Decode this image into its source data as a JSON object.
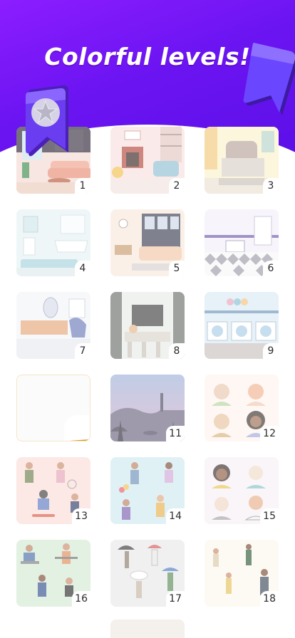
{
  "header": {
    "title": "Colorful levels!"
  },
  "levels": [
    {
      "number": "1",
      "theme": "living-room"
    },
    {
      "number": "2",
      "theme": "fireplace-room"
    },
    {
      "number": "3",
      "theme": "bedroom"
    },
    {
      "number": "4",
      "theme": "bathroom"
    },
    {
      "number": "5",
      "theme": "lounge"
    },
    {
      "number": "6",
      "theme": "kitchen"
    },
    {
      "number": "7",
      "theme": "hallway"
    },
    {
      "number": "8",
      "theme": "cafe-bar"
    },
    {
      "number": "9",
      "theme": "laundry"
    },
    {
      "number": "",
      "theme": "locked",
      "badge": "star-icon"
    },
    {
      "number": "11",
      "theme": "island-sunset"
    },
    {
      "number": "12",
      "theme": "portraits"
    },
    {
      "number": "13",
      "theme": "street-people"
    },
    {
      "number": "14",
      "theme": "park-people"
    },
    {
      "number": "15",
      "theme": "portraits-2"
    },
    {
      "number": "16",
      "theme": "office"
    },
    {
      "number": "17",
      "theme": "rain-umbrellas"
    },
    {
      "number": "18",
      "theme": "crowd"
    }
  ],
  "colors": {
    "accent": "#7a18f7",
    "ribbon": "#5b2ee0",
    "star_badge": "#f2b233"
  }
}
